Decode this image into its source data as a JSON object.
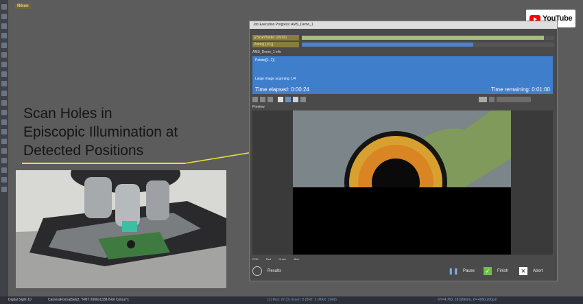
{
  "app": {
    "logo": "Nikon"
  },
  "youtube": {
    "label": "YouTube"
  },
  "caption": {
    "lines": [
      "Scan Holes in",
      "Episcopic Illumination at",
      "Detected Positions"
    ]
  },
  "dialog": {
    "title": "Job Execution Progress: AMS_Demo_1",
    "progress": [
      {
        "label": "[ZScanHolder (26/26)",
        "fraction": 0.96,
        "fill": "#a7be7d"
      },
      {
        "label": "Points[ (1/1)]",
        "fraction": 0.68,
        "fill": "#4f82c9"
      }
    ],
    "job_name": "AMS_Demo_1 info",
    "status": {
      "points": "Points[(1, 1)]",
      "scanning": "Large Image scanning: 1/4",
      "time_elapsed": "Time elapsed: 0:00:24",
      "time_remaining": "Time remaining: 0:01:00"
    },
    "preview_label": "Preview",
    "legend": [
      "RGB",
      "Red",
      "Green",
      "Blue"
    ],
    "buttons": {
      "results": "Results",
      "pause": "Pause",
      "finish": "Finish",
      "abort": "Abort"
    }
  },
  "statusbar": {
    "left": "Digital Sight 10",
    "command": "CameraFormatSet(2, \"FMT 2000x1338 8-bit Colour\");",
    "center": "(1) Red: 97 (3) Green: 8 (BRT: 2 (MAX: 2048)",
    "coords": "XY=4,763, 18,689mm, Z=-4950,200µm"
  },
  "colors": {
    "accent": "#3f7ecb",
    "caption_line": "#e9e23a",
    "youtube_red": "#ff0000"
  }
}
